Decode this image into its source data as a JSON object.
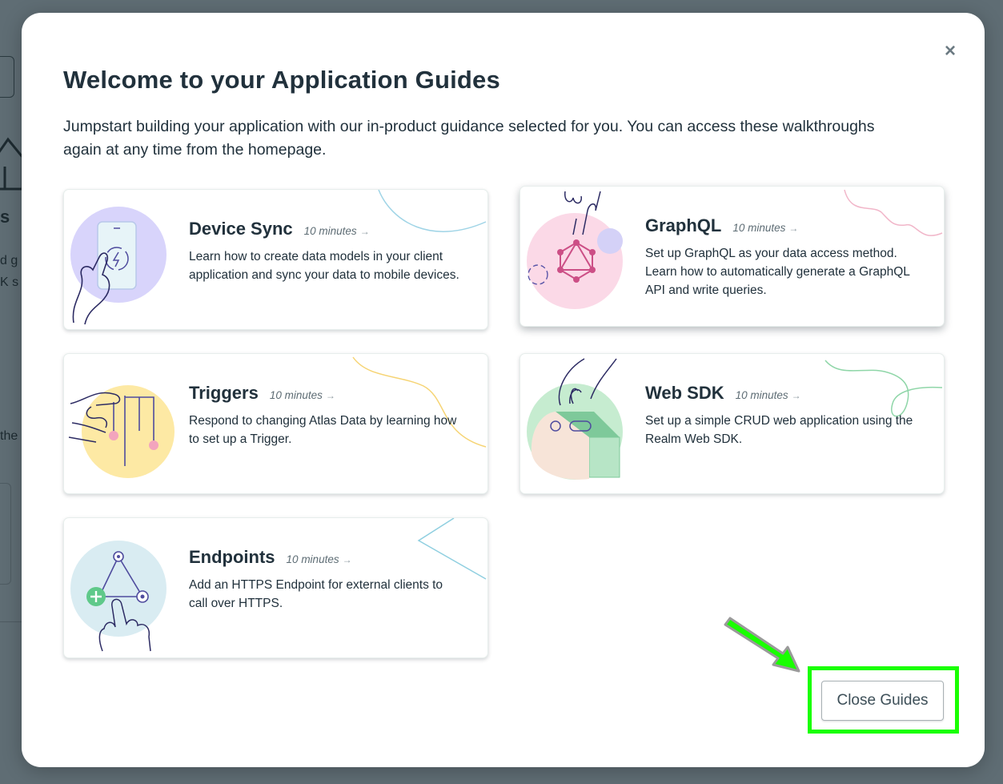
{
  "modal": {
    "title": "Welcome to your Application Guides",
    "description": "Jumpstart building your application with our in-product guidance selected for you. You can access these walkthroughs again at any time from the homepage.",
    "close_icon": "×"
  },
  "guides": [
    {
      "name": "Device Sync",
      "duration": "10 minutes",
      "description": "Learn how to create data models in your client application and sync your data to mobile devices.",
      "color": "#d8d4fb"
    },
    {
      "name": "GraphQL",
      "duration": "10 minutes",
      "description": "Set up GraphQL as your data access method. Learn how to automatically generate a GraphQL API and write queries.",
      "color": "#fbd9e7"
    },
    {
      "name": "Triggers",
      "duration": "10 minutes",
      "description": "Respond to changing Atlas Data by learning how to set up a Trigger.",
      "color": "#fde9a4"
    },
    {
      "name": "Web SDK",
      "duration": "10 minutes",
      "description": "Set up a simple CRUD web application using the Realm Web SDK.",
      "color": "#c6ecd0"
    },
    {
      "name": "Endpoints",
      "duration": "10 minutes",
      "description": "Add an HTTPS Endpoint for external clients to call over HTTPS.",
      "color": "#d9ecf2"
    }
  ],
  "arrow_glyph": "→",
  "footer": {
    "close_button_label": "Close Guides"
  },
  "background": {
    "fragment_s": "s",
    "fragment_dg": "d g",
    "fragment_ks": "K s",
    "fragment_the": "the"
  },
  "annotation": {
    "highlight_color": "#19ff00"
  }
}
